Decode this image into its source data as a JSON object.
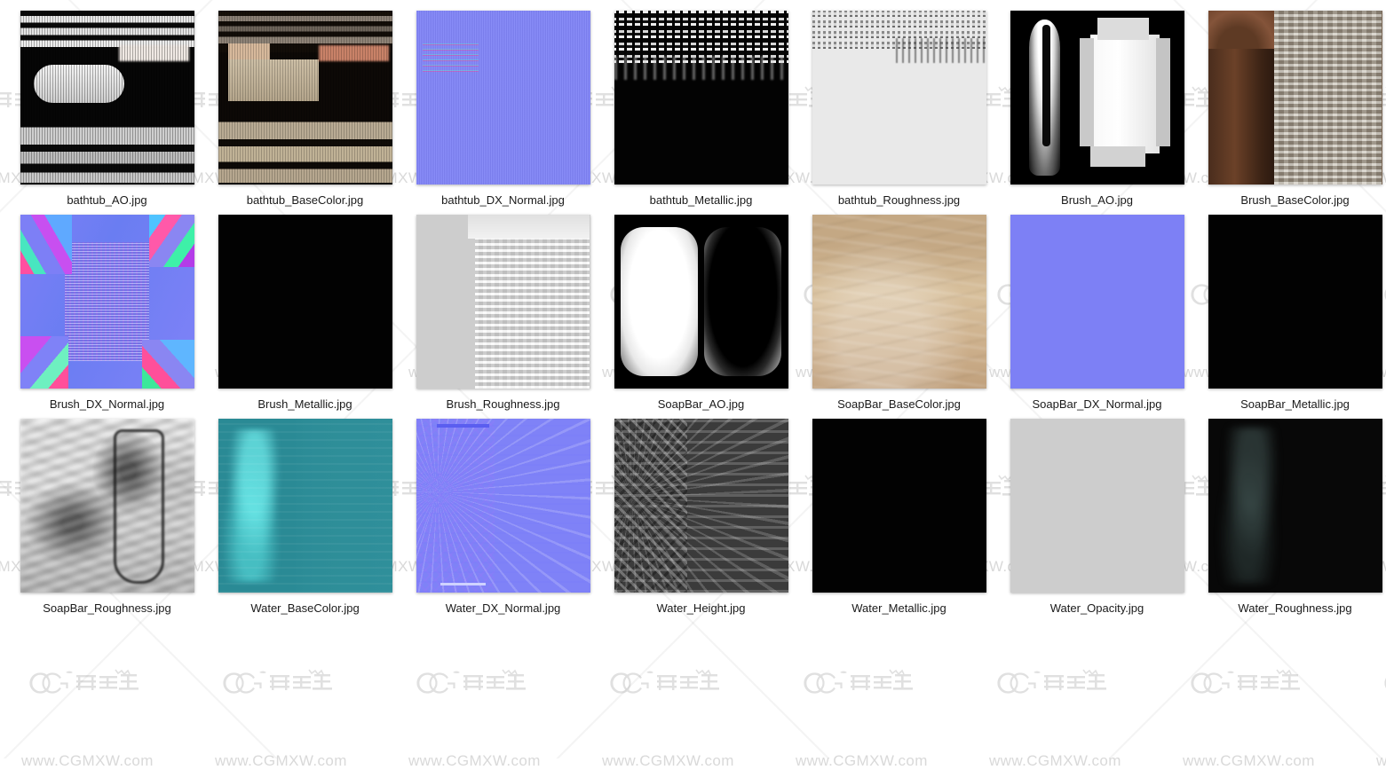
{
  "page": {
    "type": "texture-thumbnail-grid",
    "background_color": "#ffffff",
    "columns": 7,
    "rows": 3,
    "total_items": 21
  },
  "watermark": {
    "logo_text_latin": "CG",
    "logo_text_cjk": "模型主",
    "url": "www.CGMXW.com",
    "color": "#e8e8e8",
    "pattern": "diagonal-cross-lattice"
  },
  "items": [
    {
      "label": "bathtub_AO.jpg",
      "surface": "tx-bathtub-ao"
    },
    {
      "label": "bathtub_BaseColor.jpg",
      "surface": "tx-bathtub-bc"
    },
    {
      "label": "bathtub_DX_Normal.jpg",
      "surface": "tx-bathtub-nm"
    },
    {
      "label": "bathtub_Metallic.jpg",
      "surface": "tx-bathtub-me"
    },
    {
      "label": "bathtub_Roughness.jpg",
      "surface": "tx-bathtub-ro"
    },
    {
      "label": "Brush_AO.jpg",
      "surface": "tx-brush-ao"
    },
    {
      "label": "Brush_BaseColor.jpg",
      "surface": "tx-brush-bc"
    },
    {
      "label": "Brush_DX_Normal.jpg",
      "surface": "tx-brush-nm"
    },
    {
      "label": "Brush_Metallic.jpg",
      "surface": "tx-black"
    },
    {
      "label": "Brush_Roughness.jpg",
      "surface": "tx-brush-ro"
    },
    {
      "label": "SoapBar_AO.jpg",
      "surface": "tx-soap-ao"
    },
    {
      "label": "SoapBar_BaseColor.jpg",
      "surface": "tx-soap-bc"
    },
    {
      "label": "SoapBar_DX_Normal.jpg",
      "surface": "tx-flatnormal"
    },
    {
      "label": "SoapBar_Metallic.jpg",
      "surface": "tx-black"
    },
    {
      "label": "SoapBar_Roughness.jpg",
      "surface": "tx-soap-ro"
    },
    {
      "label": "Water_BaseColor.jpg",
      "surface": "tx-water-bc"
    },
    {
      "label": "Water_DX_Normal.jpg",
      "surface": "tx-water-nm"
    },
    {
      "label": "Water_Height.jpg",
      "surface": "tx-water-he"
    },
    {
      "label": "Water_Metallic.jpg",
      "surface": "tx-black"
    },
    {
      "label": "Water_Opacity.jpg",
      "surface": "tx-opacity"
    },
    {
      "label": "Water_Roughness.jpg",
      "surface": "tx-water-ro"
    }
  ]
}
